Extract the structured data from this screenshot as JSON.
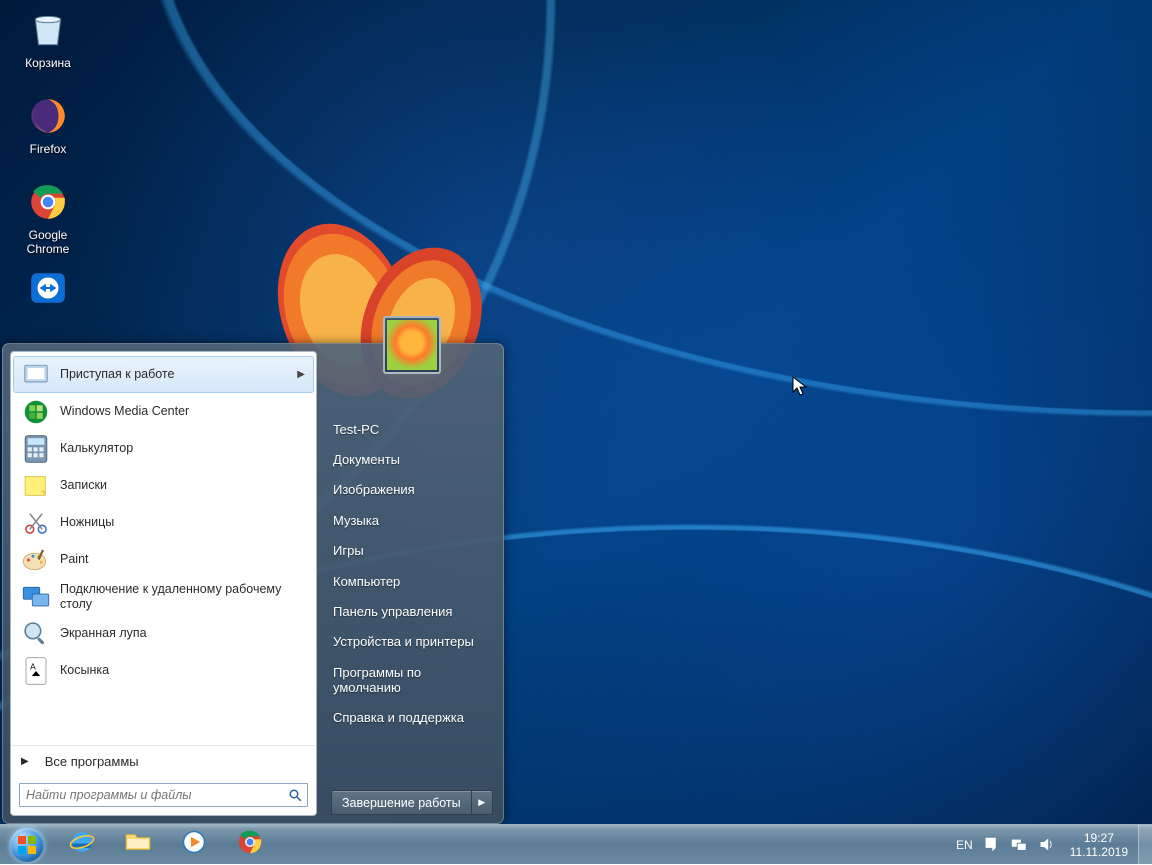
{
  "desktop": {
    "icons": [
      {
        "name": "recycle-bin-icon",
        "label": "Корзина"
      },
      {
        "name": "firefox-icon",
        "label": "Firefox"
      },
      {
        "name": "chrome-icon",
        "label": "Google Chrome"
      },
      {
        "name": "teamviewer-icon",
        "label": ""
      }
    ]
  },
  "startmenu": {
    "programs": [
      {
        "label": "Приступая к работе",
        "has_arrow": true,
        "highlighted": true,
        "icon": "getting-started-icon"
      },
      {
        "label": "Windows Media Center",
        "icon": "wmc-icon"
      },
      {
        "label": "Калькулятор",
        "icon": "calculator-icon"
      },
      {
        "label": "Записки",
        "icon": "sticky-notes-icon"
      },
      {
        "label": "Ножницы",
        "icon": "snipping-tool-icon"
      },
      {
        "label": "Paint",
        "icon": "paint-icon"
      },
      {
        "label": "Подключение к удаленному рабочему столу",
        "icon": "rdp-icon"
      },
      {
        "label": "Экранная лупа",
        "icon": "magnifier-icon"
      },
      {
        "label": "Косынка",
        "icon": "solitaire-icon"
      }
    ],
    "all_programs": "Все программы",
    "search_placeholder": "Найти программы и файлы",
    "right_links": [
      "Test-PC",
      "Документы",
      "Изображения",
      "Музыка",
      "Игры",
      "Компьютер",
      "Панель управления",
      "Устройства и принтеры",
      "Программы по умолчанию",
      "Справка и поддержка"
    ],
    "shutdown_label": "Завершение работы"
  },
  "taskbar": {
    "pins": [
      {
        "name": "ie-icon"
      },
      {
        "name": "explorer-icon"
      },
      {
        "name": "wmp-icon"
      },
      {
        "name": "chrome-icon"
      }
    ],
    "tray": {
      "language": "EN",
      "time": "19:27",
      "date": "11.11.2019"
    }
  }
}
